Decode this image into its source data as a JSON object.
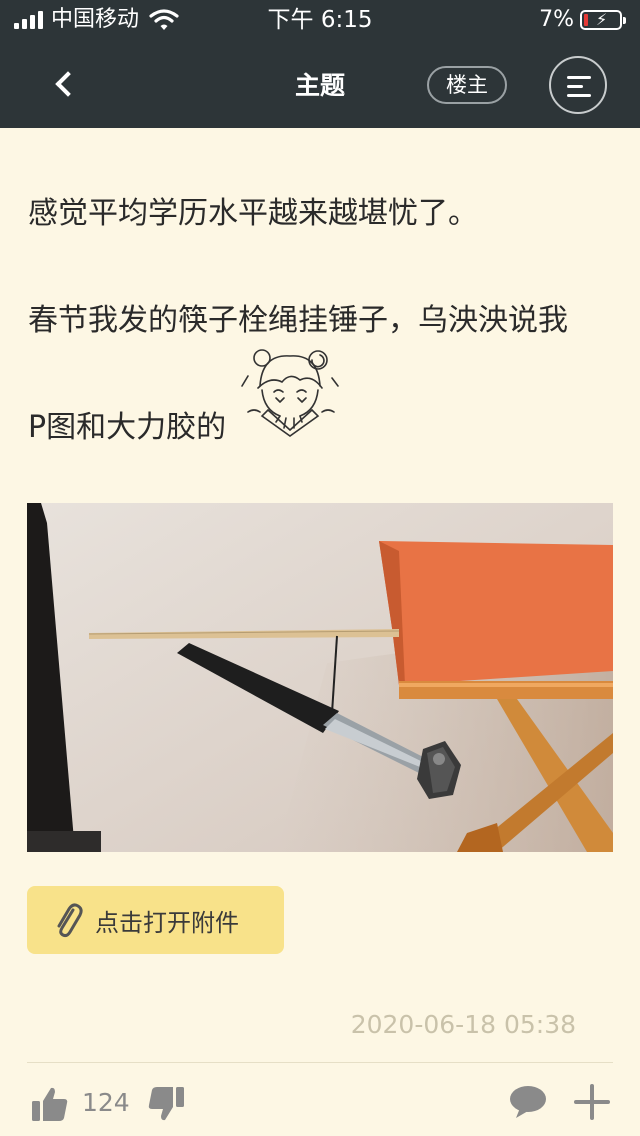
{
  "status_bar": {
    "carrier": "中国移动",
    "time": "下午 6:15",
    "battery_percent": "7%"
  },
  "nav": {
    "title": "主题",
    "op_label": "楼主"
  },
  "post": {
    "lines": [
      "感觉平均学历水平越来越堪忧了。",
      "春节我发的筷子栓绳挂锤子，乌泱泱说我",
      "P图和大力胶的"
    ],
    "attachment_label": "点击打开附件",
    "timestamp": "2020-06-18 05:38",
    "like_count": "124"
  },
  "colors": {
    "header_bg": "#2d3538",
    "page_bg": "#fdf7e4",
    "attachment_bg": "#f8e28a"
  },
  "icons": [
    "back-icon",
    "menu-icon",
    "wifi-icon",
    "battery-icon",
    "paperclip-icon",
    "thumbs-up-icon",
    "thumbs-down-icon",
    "comment-icon",
    "plus-icon"
  ]
}
